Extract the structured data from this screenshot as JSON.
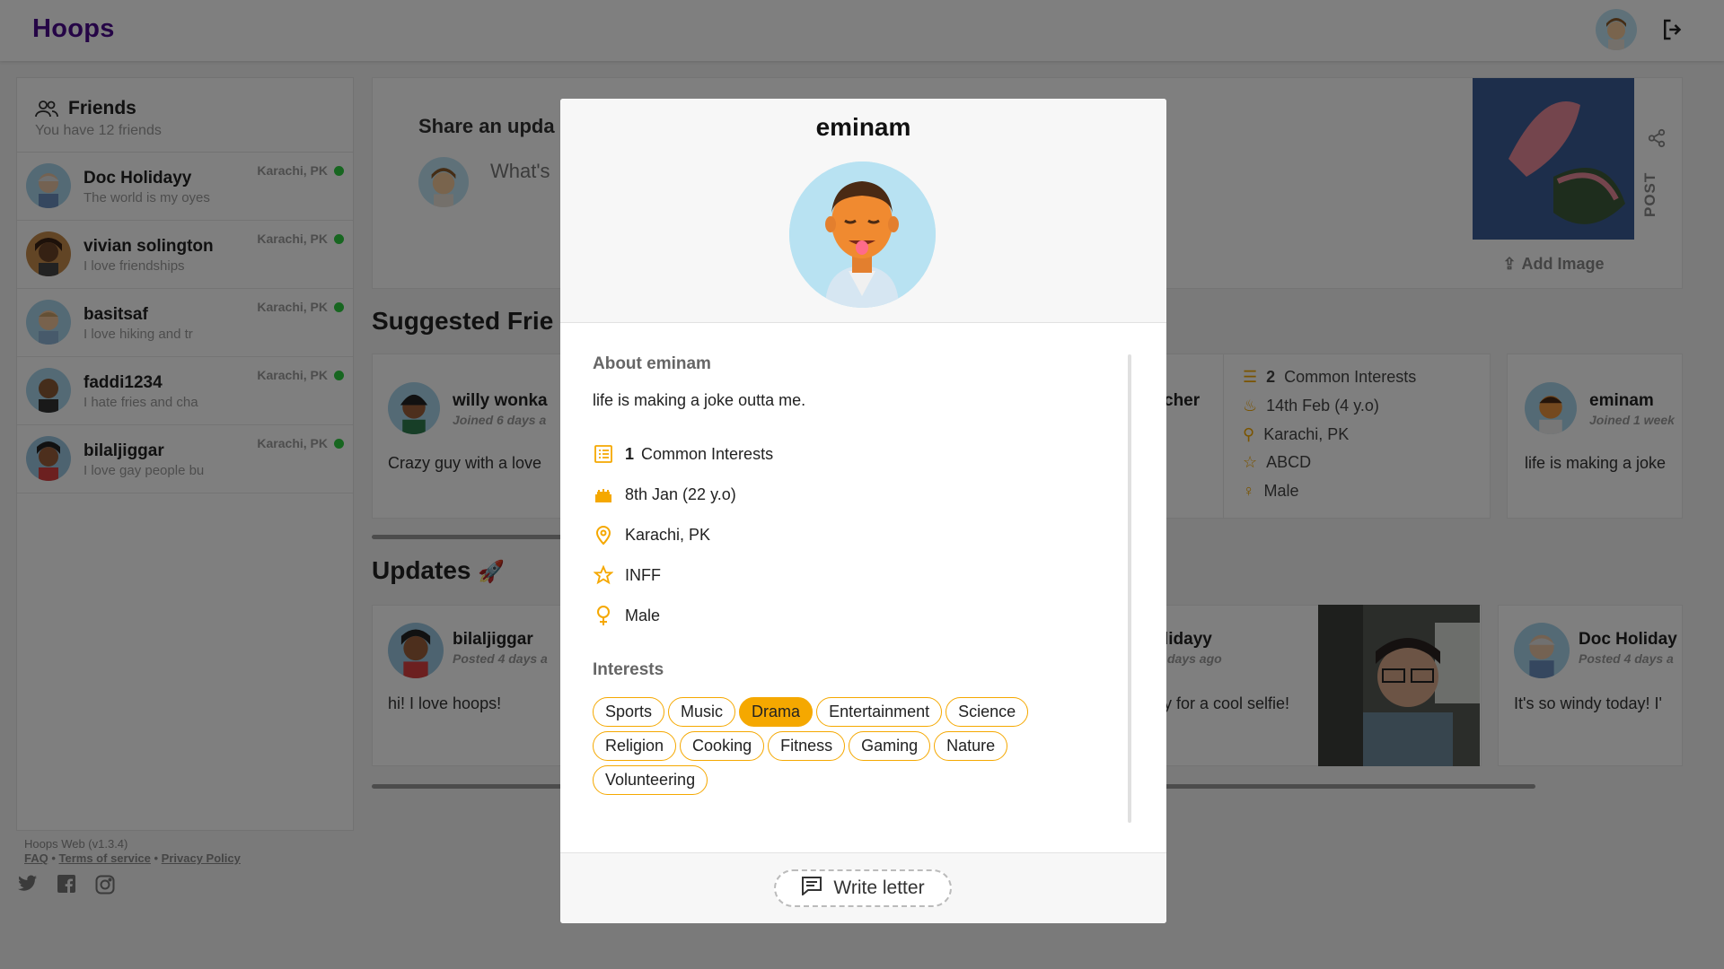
{
  "app": {
    "brand": "Hoops"
  },
  "sidebar": {
    "title": "Friends",
    "subtitle": "You have 12 friends",
    "friends": [
      {
        "name": "Doc Holidayy",
        "status": "The world is my oyes",
        "location": "Karachi, PK"
      },
      {
        "name": "vivian solington",
        "status": "I love friendships",
        "location": "Karachi, PK"
      },
      {
        "name": "basitsaf",
        "status": "I love hiking and tr",
        "location": "Karachi, PK"
      },
      {
        "name": "faddi1234",
        "status": "I hate fries and cha",
        "location": "Karachi, PK"
      },
      {
        "name": "bilaljiggar",
        "status": "I love gay people bu",
        "location": "Karachi, PK"
      }
    ],
    "footer": {
      "version": "Hoops Web (v1.3.4)",
      "faq": "FAQ",
      "terms": "Terms of service",
      "privacy": "Privacy Policy",
      "sep": " • "
    }
  },
  "share": {
    "label": "Share an upda",
    "placeholder": "What's",
    "add_image": "Add Image",
    "post": "POST"
  },
  "suggested": {
    "heading": "Suggested Frie",
    "cards": [
      {
        "name": "willy wonka",
        "sub": "Joined 6 days a",
        "text": "Crazy guy with a love"
      },
      {
        "name_partial": "cher"
      },
      {
        "count": "2",
        "label": "Common Interests",
        "birthday": "14th Feb (4 y.o)",
        "location": "Karachi, PK",
        "type": "ABCD",
        "gender": "Male"
      },
      {
        "name": "eminam",
        "sub": "Joined 1 week",
        "text": "life is making a joke"
      }
    ]
  },
  "updates": {
    "heading": "Updates",
    "cards": [
      {
        "name": "bilaljiggar",
        "sub": "Posted 4 days a",
        "text": "hi! I love hoops!"
      },
      {
        "name": "lidayy",
        "sub": "days ago",
        "text": "y for a cool selfie!"
      },
      {
        "name": "Doc Holiday",
        "sub": "Posted 4 days a",
        "text": "It's so windy today! I'"
      }
    ]
  },
  "modal": {
    "username": "eminam",
    "about_heading": "About eminam",
    "about_text": "life is making a joke outta me.",
    "common_count": "1",
    "common_label": "Common Interests",
    "birthday": "8th Jan (22 y.o)",
    "location": "Karachi, PK",
    "personality": "INFF",
    "gender": "Male",
    "interests_heading": "Interests",
    "interests": [
      "Sports",
      "Music",
      "Drama",
      "Entertainment",
      "Science",
      "Religion",
      "Cooking",
      "Fitness",
      "Gaming",
      "Nature",
      "Volunteering"
    ],
    "selected_interest": "Drama",
    "write_letter": "Write letter"
  },
  "colors": {
    "brand": "#4b0b8c",
    "accent": "#f5a800",
    "online": "#2ecc40"
  }
}
